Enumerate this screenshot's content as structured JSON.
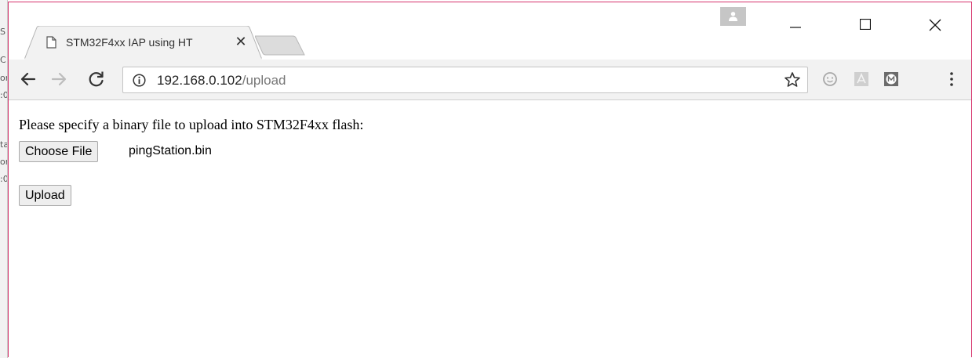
{
  "tab": {
    "title": "STM32F4xx IAP using HT",
    "close_glyph": "✕"
  },
  "address": {
    "host": "192.168.0.102",
    "path": "/upload"
  },
  "page": {
    "prompt": "Please specify a binary file to upload into STM32F4xx flash:",
    "choose_file_label": "Choose File",
    "chosen_file_name": "pingStation.bin",
    "upload_label": "Upload"
  },
  "bg_window_text": [
    "S",
    "C",
    "or",
    ":0",
    "ta",
    "or",
    ":0"
  ],
  "colors": {
    "window_border": "#d6336c",
    "toolbar_bg": "#f2f2f2",
    "tab_fill": "#f2f2f2"
  }
}
